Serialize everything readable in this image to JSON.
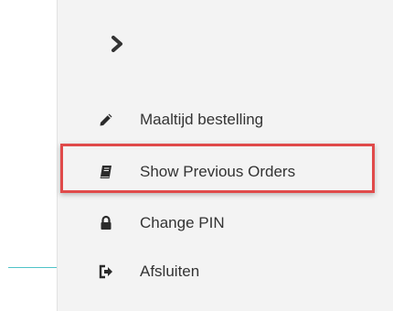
{
  "menu": {
    "toggle_icon": "chevron-right-icon",
    "items": [
      {
        "label": "Maaltijd bestelling",
        "icon": "pencil-icon"
      },
      {
        "label": "Show Previous Orders",
        "icon": "book-icon"
      },
      {
        "label": "Change PIN",
        "icon": "lock-icon"
      },
      {
        "label": "Afsluiten",
        "icon": "sign-out-icon"
      }
    ]
  },
  "colors": {
    "highlight_border": "#e04a4a",
    "accent_line": "#4fc3c7",
    "sidebar_bg": "#f3f3f3",
    "text": "#333333"
  }
}
